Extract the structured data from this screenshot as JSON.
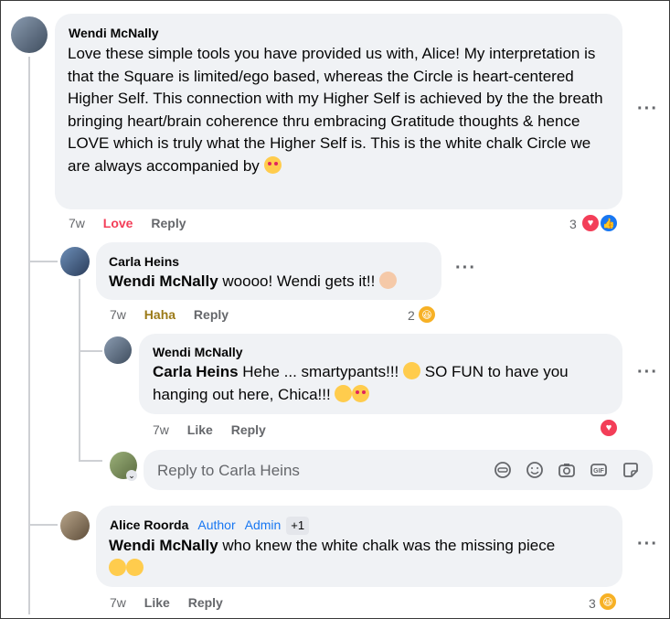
{
  "comments": [
    {
      "author": "Wendi McNally",
      "text": "Love these simple tools you have provided us with, Alice! My interpretation is that the Square is limited/ego based, whereas the Circle is heart-centered Higher Self. This connection with my Higher Self is achieved by the the breath bringing heart/brain coherence thru embracing Gratitude thoughts & hence LOVE which is truly what the Higher Self is. This is the white chalk Circle we are always accompanied by",
      "time": "7w",
      "reaction_label": "Love",
      "reply_label": "Reply",
      "reaction_count": "3"
    },
    {
      "author": "Carla Heins",
      "mention": "Wendi McNally",
      "text": " woooo! Wendi gets it!!",
      "time": "7w",
      "reaction_label": "Haha",
      "reply_label": "Reply",
      "reaction_count": "2"
    },
    {
      "author": "Wendi McNally",
      "mention": "Carla Heins",
      "text_a": " Hehe ... smartypants!!!",
      "text_b": " SO FUN to have you hanging out here, Chica!!!",
      "time": "7w",
      "like_label": "Like",
      "reply_label": "Reply"
    },
    {
      "author": "Alice Roorda",
      "badge_author": "Author",
      "badge_admin": "Admin",
      "badge_more": "+1",
      "mention": "Wendi McNally",
      "text": " who knew the white chalk was the missing piece",
      "time": "7w",
      "like_label": "Like",
      "reply_label": "Reply",
      "reaction_count": "3"
    }
  ],
  "reply_box": {
    "placeholder": "Reply to Carla Heins"
  },
  "icons": {
    "more": "more-options-icon",
    "love": "love-reaction-icon",
    "like": "like-reaction-icon",
    "haha": "haha-reaction-icon",
    "toolbar": [
      "avatar-sticker-icon",
      "emoji-icon",
      "camera-icon",
      "gif-icon",
      "sticker-icon"
    ]
  },
  "colors": {
    "love": "#f33e58",
    "like": "#1877f2",
    "haha": "#f7b125",
    "bubble": "#f0f2f5",
    "link": "#1877f2"
  }
}
